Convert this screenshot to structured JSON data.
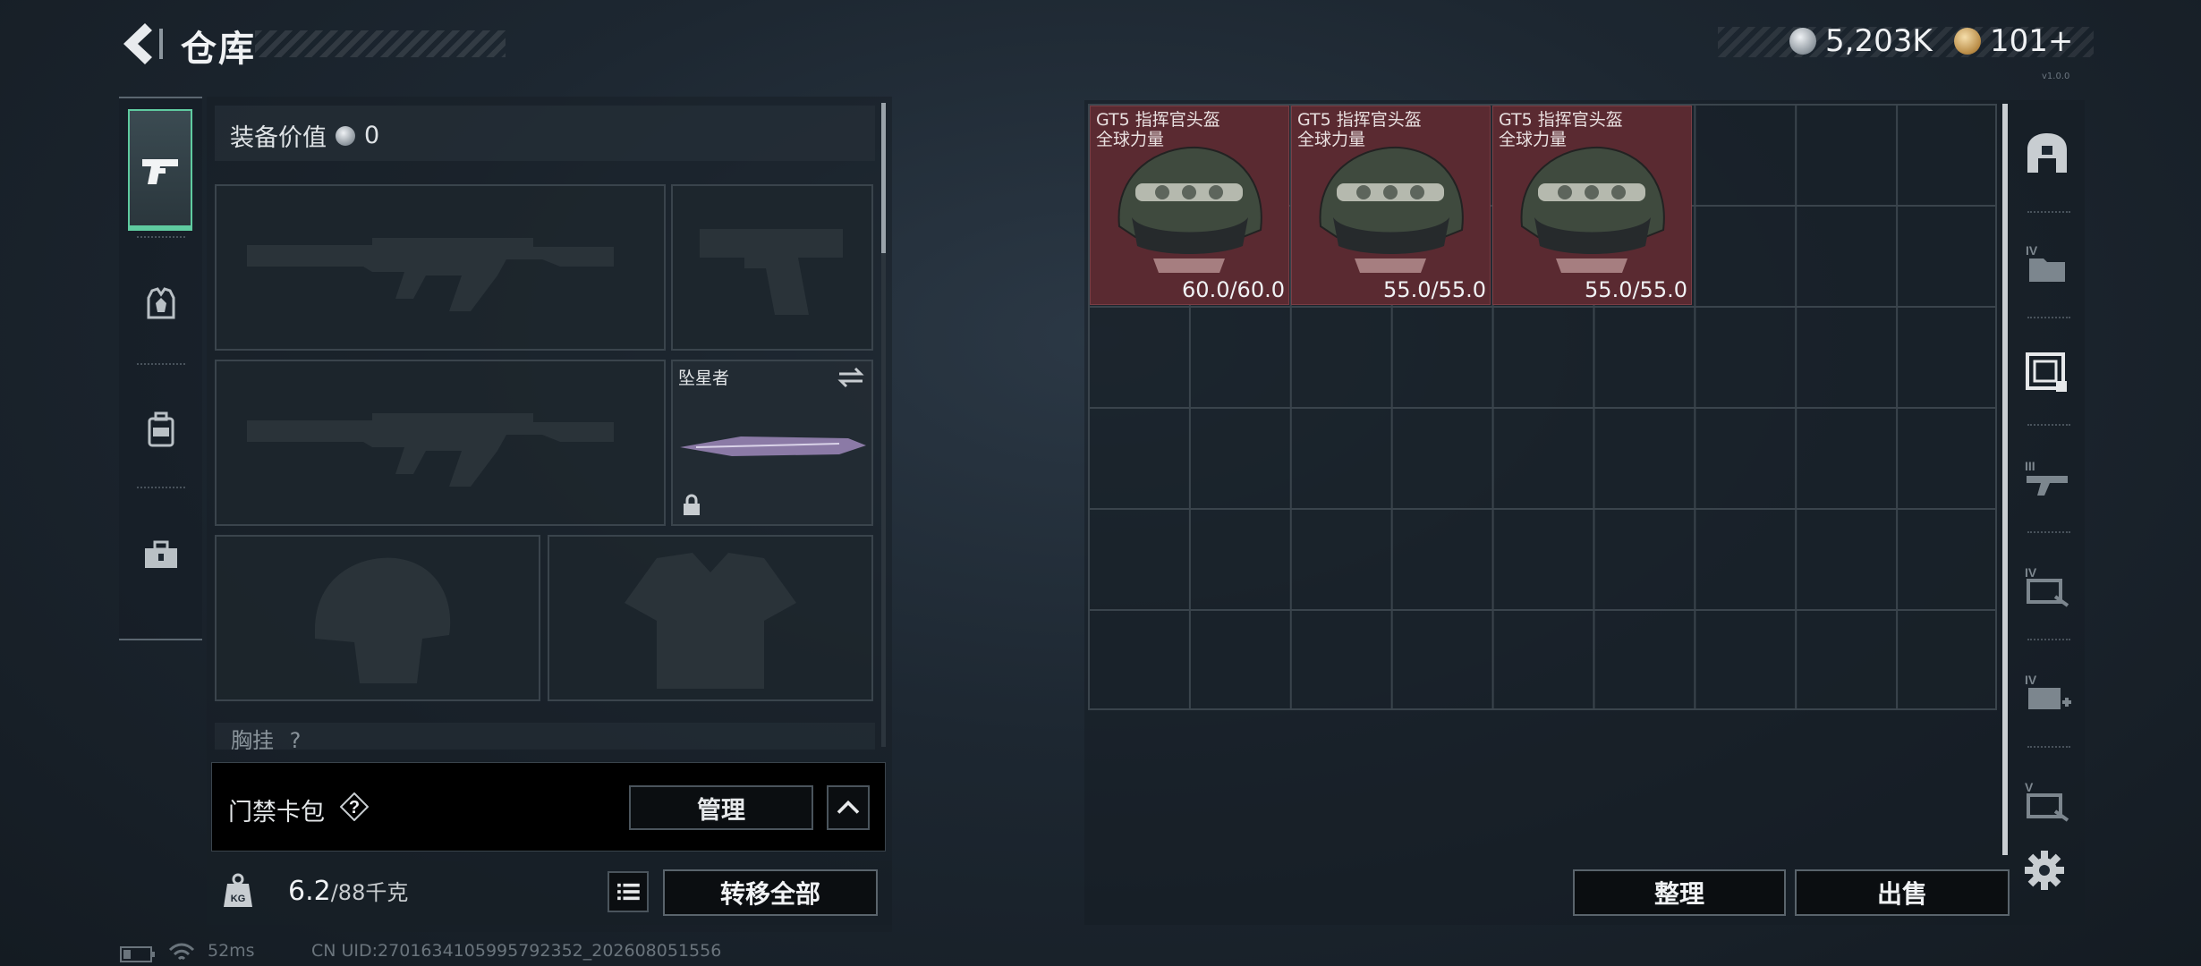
{
  "header": {
    "title": "仓库",
    "currency_silver": "5,203K",
    "currency_gold": "101+",
    "version": "v1.0.0"
  },
  "left_nav": {
    "items": [
      "pistol-icon",
      "vest-icon",
      "backpack-icon",
      "toolbox-icon"
    ],
    "active": "pistol-icon"
  },
  "equipment": {
    "value_label": "装备价值",
    "value": "0",
    "melee_label": "坠星者",
    "chest_label": "胸挂",
    "chest_badge": "?"
  },
  "keycard": {
    "label": "门禁卡包",
    "help": "?",
    "manage_label": "管理"
  },
  "capacity": {
    "current": "6.2",
    "max_label": "/88千克",
    "transfer_label": "转移全部"
  },
  "stash": {
    "items": [
      {
        "name_line1": "GT5 指挥官头盔",
        "name_line2": "全球力量",
        "durability": "60.0/60.0"
      },
      {
        "name_line1": "GT5 指挥官头盔",
        "name_line2": "全球力量",
        "durability": "55.0/55.0"
      },
      {
        "name_line1": "GT5 指挥官头盔",
        "name_line2": "全球力量",
        "durability": "55.0/55.0"
      }
    ],
    "sort_label": "整理",
    "sell_label": "出售"
  },
  "right_nav": [
    "safe-box-icon",
    "tier-iv-folder-icon",
    "selected-container-icon",
    "tier-iii-weapon-case-icon",
    "tier-iv-ammo-case-icon",
    "tier-iv-medical-case-icon",
    "tier-v-case-icon"
  ],
  "footer": {
    "ping": "52ms",
    "uid": "CN UID:2701634105995792352_202608051556"
  },
  "colors": {
    "accent": "#5fcba0",
    "item_bg": "#5a2a31"
  }
}
